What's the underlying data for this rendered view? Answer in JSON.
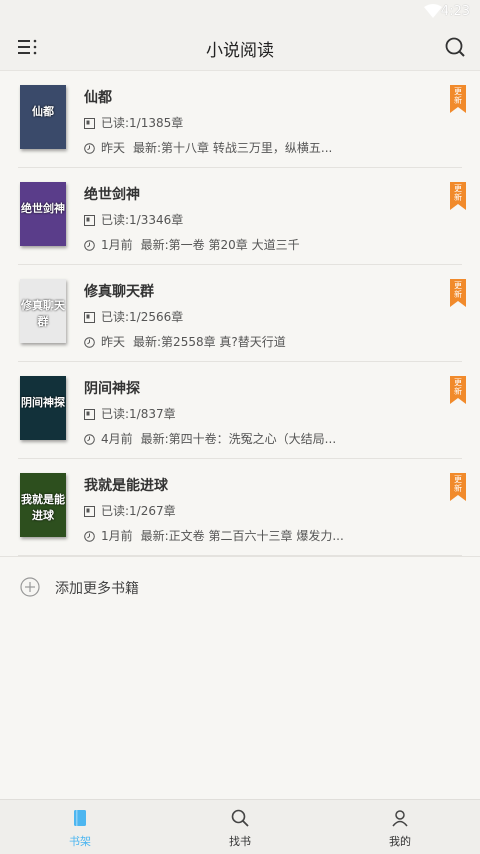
{
  "status": {
    "time": "4:23"
  },
  "header": {
    "title": "小说阅读"
  },
  "books": [
    {
      "name": "仙都",
      "read": "已读:1/1385章",
      "updated_when": "昨天",
      "latest": "最新:第十八章 转战三万里，纵横五...",
      "cover_text": "仙都",
      "cover_color": "#3a4a6a",
      "badge": "更新"
    },
    {
      "name": "绝世剑神",
      "read": "已读:1/3346章",
      "updated_when": "1月前",
      "latest": "最新:第一卷 第20章 大道三千",
      "cover_text": "绝世剑神",
      "cover_color": "#5a3d8a",
      "badge": "更新"
    },
    {
      "name": "修真聊天群",
      "read": "已读:1/2566章",
      "updated_when": "昨天",
      "latest": "最新:第2558章 真?替天行道",
      "cover_text": "修真聊天群",
      "cover_color": "#e9e9e9",
      "badge": "更新"
    },
    {
      "name": "阴间神探",
      "read": "已读:1/837章",
      "updated_when": "4月前",
      "latest": "最新:第四十卷：洗冤之心（大结局...",
      "cover_text": "阴间神探",
      "cover_color": "#12313a",
      "badge": "更新"
    },
    {
      "name": "我就是能进球",
      "read": "已读:1/267章",
      "updated_when": "1月前",
      "latest": "最新:正文卷 第二百六十三章 爆发力...",
      "cover_text": "我就是能进球",
      "cover_color": "#2d4f1e",
      "badge": "更新"
    }
  ],
  "add_more": {
    "label": "添加更多书籍"
  },
  "tabs": [
    {
      "label": "书架",
      "active": true,
      "icon": "book-icon"
    },
    {
      "label": "找书",
      "active": false,
      "icon": "search-book-icon"
    },
    {
      "label": "我的",
      "active": false,
      "icon": "user-icon"
    }
  ],
  "colors": {
    "accent": "#4db6f0",
    "ribbon": "#f18a2b"
  }
}
